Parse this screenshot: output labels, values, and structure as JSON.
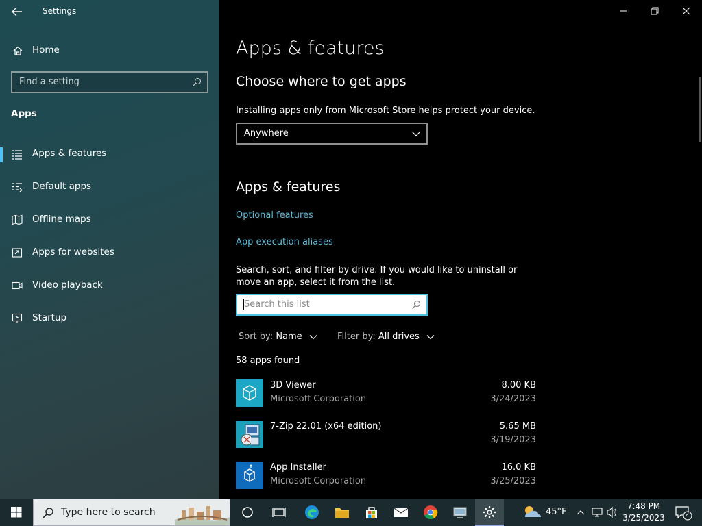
{
  "window": {
    "title": "Settings",
    "controls": [
      "minimize",
      "maximize",
      "close"
    ]
  },
  "sidebar": {
    "home_label": "Home",
    "search_placeholder": "Find a setting",
    "section_heading": "Apps",
    "items": [
      {
        "label": "Apps & features",
        "icon": "apps-features-icon",
        "active": true
      },
      {
        "label": "Default apps",
        "icon": "default-apps-icon",
        "active": false
      },
      {
        "label": "Offline maps",
        "icon": "offline-maps-icon",
        "active": false
      },
      {
        "label": "Apps for websites",
        "icon": "apps-websites-icon",
        "active": false
      },
      {
        "label": "Video playback",
        "icon": "video-playback-icon",
        "active": false
      },
      {
        "label": "Startup",
        "icon": "startup-icon",
        "active": false
      }
    ]
  },
  "main": {
    "page_title": "Apps & features",
    "choose_heading": "Choose where to get apps",
    "install_description": "Installing apps only from Microsoft Store helps protect your device.",
    "source_dropdown_value": "Anywhere",
    "apps_features_heading": "Apps & features",
    "links": {
      "optional_features": "Optional features",
      "execution_aliases": "App execution aliases"
    },
    "search_description": "Search, sort, and filter by drive. If you would like to uninstall or move an app, select it from the list.",
    "search_placeholder": "Search this list",
    "sort": {
      "label": "Sort by:",
      "value": "Name"
    },
    "filter": {
      "label": "Filter by:",
      "value": "All drives"
    },
    "apps_found": "58 apps found",
    "apps": [
      {
        "name": "3D Viewer",
        "publisher": "Microsoft Corporation",
        "size": "8.00 KB",
        "date": "3/24/2023",
        "icon": "3d-viewer-icon"
      },
      {
        "name": "7-Zip 22.01 (x64 edition)",
        "publisher": "",
        "size": "5.65 MB",
        "date": "3/19/2023",
        "icon": "7zip-icon"
      },
      {
        "name": "App Installer",
        "publisher": "Microsoft Corporation",
        "size": "16.0 KB",
        "date": "3/25/2023",
        "icon": "app-installer-icon"
      }
    ]
  },
  "taskbar": {
    "search_placeholder": "Type here to search",
    "weather_temp": "45°F",
    "time": "7:48 PM",
    "date": "3/25/2023",
    "notification_count": "2",
    "colors": {
      "accent": "#4fc3f7",
      "link": "#5eb8d6"
    }
  }
}
